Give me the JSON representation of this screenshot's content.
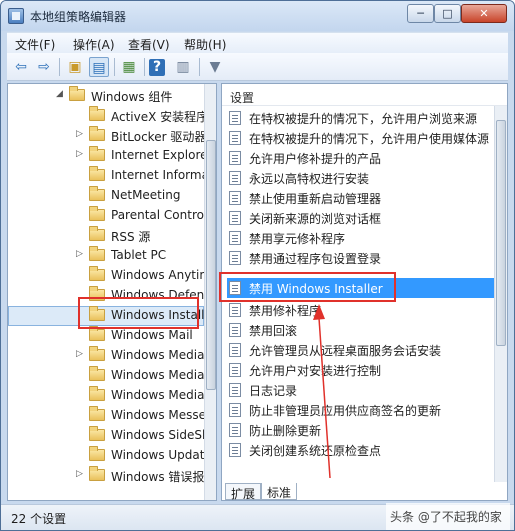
{
  "window": {
    "title": "本地组策略编辑器",
    "min": "─",
    "max": "□",
    "close": "✕"
  },
  "menu": [
    {
      "label": "文件(F)"
    },
    {
      "label": "操作(A)"
    },
    {
      "label": "查看(V)"
    },
    {
      "label": "帮助(H)"
    }
  ],
  "toolbar": [
    {
      "icon": "back-arrow-icon",
      "glyph": "⇦"
    },
    {
      "icon": "forward-arrow-icon",
      "glyph": "⇨"
    },
    {
      "icon": "up-folder-icon",
      "glyph": "▣"
    },
    {
      "icon": "show-tree-icon",
      "glyph": "▤"
    },
    {
      "icon": "export-icon",
      "glyph": "▦"
    },
    {
      "icon": "help-icon",
      "glyph": "?"
    },
    {
      "icon": "properties-icon",
      "glyph": "▥"
    },
    {
      "icon": "filter-icon",
      "glyph": "▼"
    }
  ],
  "tree": [
    {
      "label": "Windows 组件",
      "arrow": "◢",
      "level": 0
    },
    {
      "label": "ActiveX 安装程序",
      "arrow": "",
      "level": 1
    },
    {
      "label": "BitLocker 驱动器",
      "arrow": "▷",
      "level": 1
    },
    {
      "label": "Internet Explorer",
      "arrow": "▷",
      "level": 1
    },
    {
      "label": "Internet Information",
      "arrow": "",
      "level": 1
    },
    {
      "label": "NetMeeting",
      "arrow": "",
      "level": 1
    },
    {
      "label": "Parental Controls",
      "arrow": "",
      "level": 1
    },
    {
      "label": "RSS 源",
      "arrow": "",
      "level": 1
    },
    {
      "label": "Tablet PC",
      "arrow": "▷",
      "level": 1
    },
    {
      "label": "Windows Anytime",
      "arrow": "",
      "level": 1
    },
    {
      "label": "Windows Defender",
      "arrow": "",
      "level": 1
    },
    {
      "label": "Windows Installer",
      "arrow": "",
      "level": 1,
      "selected": true
    },
    {
      "label": "Windows Mail",
      "arrow": "",
      "level": 1
    },
    {
      "label": "Windows Media",
      "arrow": "▷",
      "level": 1
    },
    {
      "label": "Windows Media",
      "arrow": "",
      "level": 1
    },
    {
      "label": "Windows Media",
      "arrow": "",
      "level": 1
    },
    {
      "label": "Windows Messenger",
      "arrow": "",
      "level": 1
    },
    {
      "label": "Windows SideShow",
      "arrow": "",
      "level": 1
    },
    {
      "label": "Windows Update",
      "arrow": "",
      "level": 1
    },
    {
      "label": "Windows 错误报告",
      "arrow": "▷",
      "level": 1
    }
  ],
  "settings": {
    "header": "设置",
    "items": [
      {
        "label": "在特权被提升的情况下，允许用户浏览来源"
      },
      {
        "label": "在特权被提升的情况下，允许用户使用媒体源"
      },
      {
        "label": "允许用户修补提升的产品"
      },
      {
        "label": "永远以高特权进行安装"
      },
      {
        "label": "禁止使用重新启动管理器"
      },
      {
        "label": "关闭新来源的浏览对话框"
      },
      {
        "label": "禁用享元修补程序"
      },
      {
        "label": "禁用通过程序包设置登录"
      },
      {
        "label": "禁用 Windows Installer",
        "selected": true
      },
      {
        "label": "禁用修补程序"
      },
      {
        "label": "禁用回滚"
      },
      {
        "label": "允许管理员从远程桌面服务会话安装"
      },
      {
        "label": "允许用户对安装进行控制"
      },
      {
        "label": "日志记录"
      },
      {
        "label": "防止非管理员应用供应商签名的更新"
      },
      {
        "label": "防止删除更新"
      },
      {
        "label": "关闭创建系统还原检查点"
      }
    ]
  },
  "tabs": [
    {
      "label": "扩展"
    },
    {
      "label": "标准",
      "active": true
    }
  ],
  "status": {
    "text": "22 个设置"
  },
  "watermark": {
    "text": "头条 @了不起我的家"
  }
}
